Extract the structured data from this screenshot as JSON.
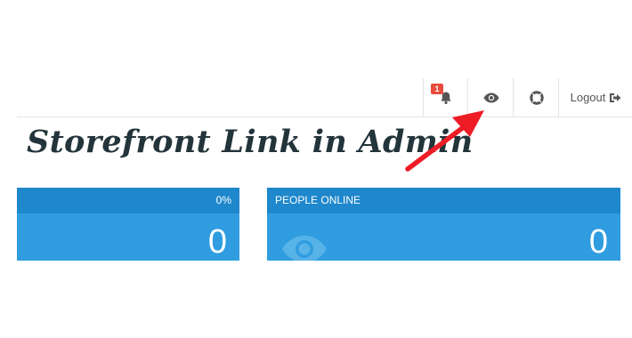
{
  "header": {
    "notifications": {
      "count": "1",
      "icon": "bell-icon"
    },
    "storefront": {
      "icon": "eye-icon"
    },
    "help": {
      "icon": "lifebuoy-icon"
    },
    "logout": {
      "label": "Logout",
      "icon": "sign-out-icon"
    }
  },
  "headline": "Storefront Link in Admin",
  "tiles": [
    {
      "title": "0%",
      "value": "0"
    },
    {
      "title": "PEOPLE ONLINE",
      "value": "0",
      "icon": "eye-icon"
    }
  ],
  "colors": {
    "tile_body": "#2f9de0",
    "tile_header": "#1f87cb",
    "badge": "#e74c3c",
    "arrow": "#ee1c25",
    "headline": "#23343b"
  }
}
